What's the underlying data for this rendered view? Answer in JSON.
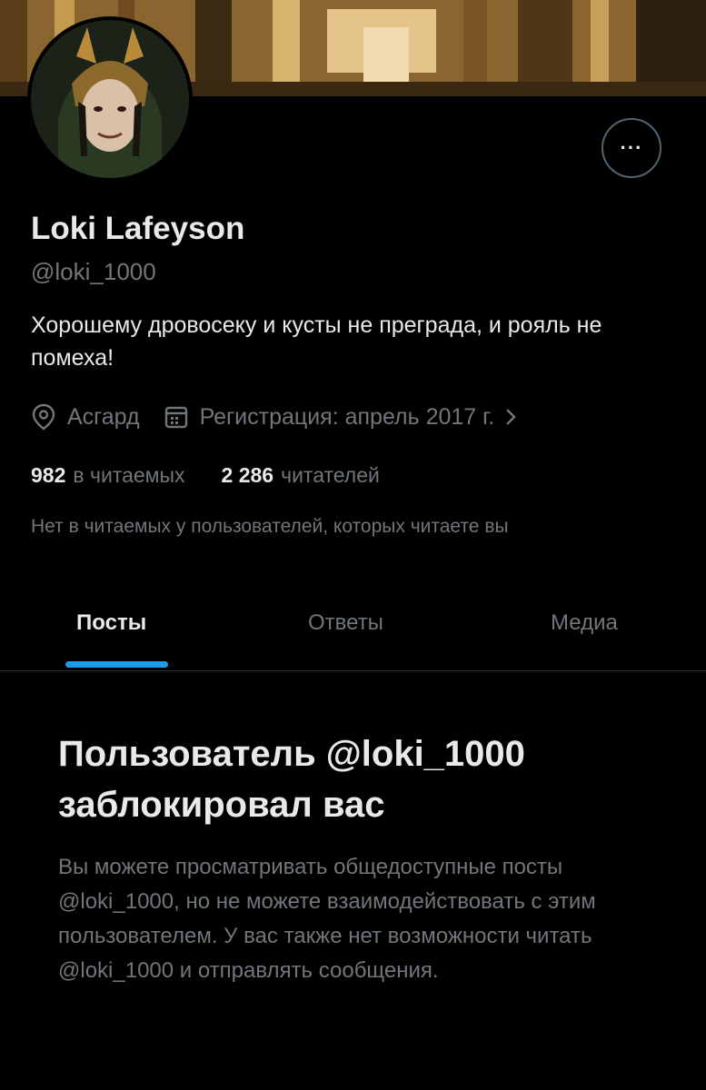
{
  "profile": {
    "name": "Loki Lafeyson",
    "handle": "@loki_1000",
    "bio": "Хорошему дровосеку и кусты не преграда, и рояль не помеха!",
    "location": "Асгард",
    "joined": "Регистрация: апрель 2017 г."
  },
  "stats": {
    "following_count": "982",
    "following_label": "в читаемых",
    "followers_count": "2 286",
    "followers_label": "читателей"
  },
  "common_followers_text": "Нет в читаемых у пользователей, которых читаете вы",
  "more_button_label": "···",
  "tabs": [
    {
      "label": "Посты",
      "active": true
    },
    {
      "label": "Ответы",
      "active": false
    },
    {
      "label": "Медиа",
      "active": false
    }
  ],
  "blocked": {
    "title": "Пользователь @loki_1000 заблокировал вас",
    "description": "Вы можете просматривать общедоступные посты @loki_1000, но не можете взаимодействовать с этим пользователем. У вас также нет возможности читать @loki_1000 и отправлять сообщения."
  },
  "colors": {
    "accent": "#1d9bf0",
    "background": "#000000",
    "secondary_text": "#71767b",
    "primary_text": "#e7e9ea"
  },
  "icons": [
    "location-pin-icon",
    "calendar-icon",
    "chevron-right-icon",
    "more-dots-icon"
  ]
}
